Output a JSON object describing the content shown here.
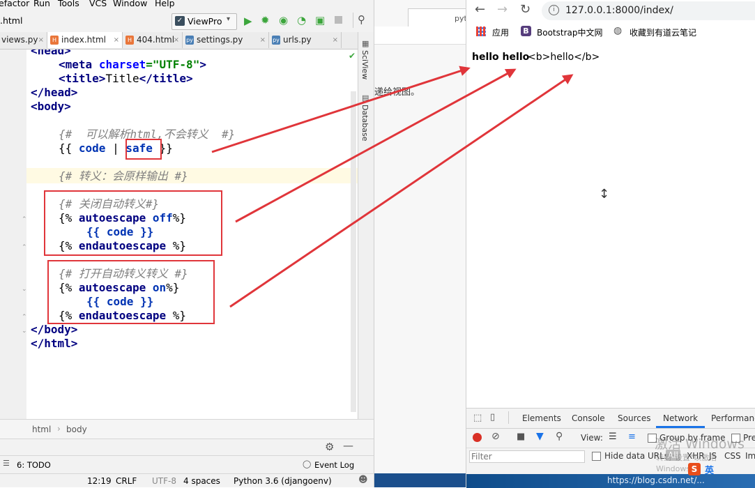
{
  "ide": {
    "menu": [
      "efactor",
      "Run",
      "Tools",
      "VCS",
      "Window",
      "Help"
    ],
    "breadcrumb_file": ".html",
    "run_config": "ViewPro",
    "tabs": [
      {
        "label": "views.py",
        "icon": "python-file-icon"
      },
      {
        "label": "index.html",
        "icon": "html-file-icon",
        "active": true
      },
      {
        "label": "404.html",
        "icon": "html-file-icon"
      },
      {
        "label": "settings.py",
        "icon": "python-file-icon"
      },
      {
        "label": "urls.py",
        "icon": "python-file-icon"
      }
    ],
    "code_lines": {
      "l1": "<head>",
      "meta_tag": "<meta",
      "meta_attr": "charset",
      "meta_eq": "=",
      "meta_val": "\"UTF-8\"",
      "meta_close": ">",
      "title_open": "<title>",
      "title_text": "Title",
      "title_close": "</title>",
      "head_close": "</head>",
      "body_open": "<body>",
      "c1": "{#  可以解析html,不会转义  #}",
      "v1_open": "{{",
      "v1_var": "code",
      "v1_pipe": "|",
      "v1_filter": "safe",
      "v1_close": "}}",
      "c2": "{# 转义：会原样输出 #}",
      "c3": "{# 关闭自动转义#}",
      "ae1_open": "{%",
      "ae1_kw": "autoescape",
      "ae1_val": "off",
      "ae1_close": "%}",
      "v2": "{{ code }}",
      "end1_open": "{%",
      "end1_kw": "endautoescape",
      "end1_close": "%}",
      "c4": "{# 打开自动转义转义 #}",
      "ae2_open": "{%",
      "ae2_kw": "autoescape",
      "ae2_val": "on",
      "ae2_close": "%}",
      "v3": "{{ code }}",
      "end2_open": "{%",
      "end2_kw": "endautoescape",
      "end2_close": "%}",
      "body_close": "</body>",
      "html_close": "</html>"
    },
    "side_tools": [
      "SciView",
      "Database"
    ],
    "breadcrumbs": [
      "html",
      "body"
    ],
    "toolwindow_todo": "6: TODO",
    "event_log": "Event Log",
    "status": {
      "position": "12:19",
      "line_sep": "CRLF",
      "encoding": "UTF-8",
      "indent": "4 spaces",
      "interpreter": "Python 3.6 (djangoenv)"
    }
  },
  "middle": {
    "tab_text": "pyt",
    "snippet": "递给视图。"
  },
  "browser": {
    "url": "127.0.0.1:8000/index/",
    "bookmarks": [
      "应用",
      "Bootstrap中文网",
      "收藏到有道云笔记"
    ],
    "content_bold": "hello hello",
    "content_plain": "<b>hello</b>",
    "devtools_tabs": [
      "Elements",
      "Console",
      "Sources",
      "Network",
      "Performance"
    ],
    "view_label": "View:",
    "group_by_frame": "Group by frame",
    "pre_label": "Pre",
    "filter_placeholder": "Filter",
    "hide_data_urls": "Hide data URLs",
    "filter_types": [
      "All",
      "XHR",
      "JS",
      "CSS",
      "Img"
    ],
    "watermark_main": "激活 Windows",
    "watermark_sub": "转到\"设置\"以激活 Windows。",
    "site_credit": "https://blog.csdn.net/...",
    "ime_label": "英"
  },
  "colors": {
    "annotation_red": "#e0353a",
    "run_green": "#3ca63c"
  }
}
